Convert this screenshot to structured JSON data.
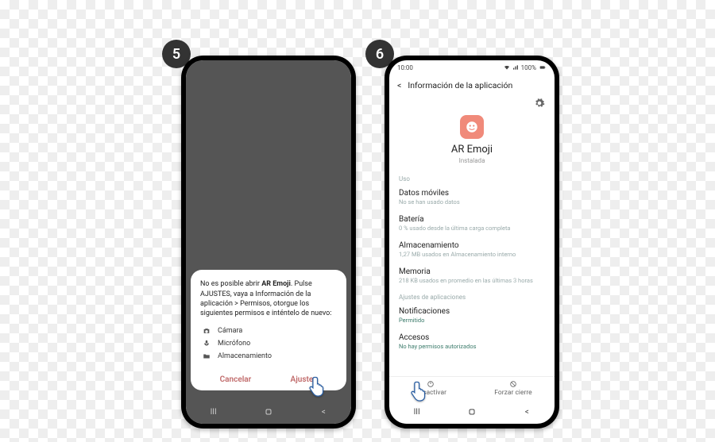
{
  "steps": {
    "s5": "5",
    "s6": "6"
  },
  "dialog": {
    "msg_prefix": "No es posible abrir ",
    "msg_app": "AR Emoji",
    "msg_suffix": ". Pulse AJUSTES, vaya a Información de la aplicación > Permisos, otorgue los siguientes permisos e inténtelo de nuevo:",
    "perm_camera": "Cámara",
    "perm_mic": "Micrófono",
    "perm_storage": "Almacenamiento",
    "cancel": "Cancelar",
    "settings": "Ajustes"
  },
  "status": {
    "time": "10:00",
    "battery": "100%"
  },
  "p2header": {
    "title": "Información de la aplicación"
  },
  "app": {
    "name": "AR Emoji",
    "state": "Instalada"
  },
  "sections": {
    "uso": "Uso",
    "data_t": "Datos móviles",
    "data_s": "No se han usado datos",
    "bat_t": "Batería",
    "bat_s": "0 % usado desde la última carga completa",
    "sto_t": "Almacenamiento",
    "sto_s": "1,27 MB usados en Almacenamiento interno",
    "mem_t": "Memoria",
    "mem_s": "218 KB usados en promedio en las últimas 3 horas",
    "ajustes": "Ajustes de aplicaciones",
    "not_t": "Notificaciones",
    "not_s": "Permitido",
    "acc_t": "Accesos",
    "acc_s": "No hay permisos autorizados"
  },
  "bottom": {
    "disable": "Desactivar",
    "force": "Forzar cierre"
  }
}
